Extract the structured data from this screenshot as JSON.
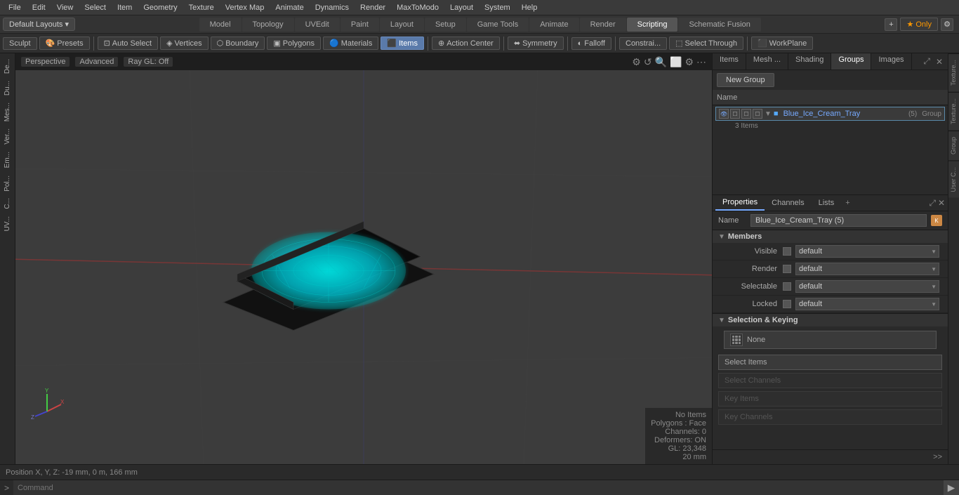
{
  "menu": {
    "items": [
      "File",
      "Edit",
      "View",
      "Select",
      "Item",
      "Geometry",
      "Texture",
      "Vertex Map",
      "Animate",
      "Dynamics",
      "Render",
      "MaxToModo",
      "Layout",
      "System",
      "Help"
    ]
  },
  "layout_bar": {
    "dropdown": "Default Layouts ▾",
    "tabs": [
      "Model",
      "Topology",
      "UVEdit",
      "Paint",
      "Layout",
      "Setup",
      "Game Tools",
      "Animate",
      "Render",
      "Scripting",
      "Schematic Fusion"
    ],
    "active_tab": "Scripting",
    "plus": "+",
    "star_only": "★ Only"
  },
  "toolbar": {
    "sculpt": "Sculpt",
    "presets": "Presets",
    "auto_select": "Auto Select",
    "vertices": "Vertices",
    "boundary": "Boundary",
    "polygons": "Polygons",
    "materials": "Materials",
    "items": "Items",
    "action_center": "Action Center",
    "symmetry": "Symmetry",
    "falloff": "Falloff",
    "constraint": "Constrai...",
    "select_through": "Select Through",
    "workplane": "WorkPlane"
  },
  "viewport": {
    "mode": "Perspective",
    "shading": "Advanced",
    "render": "Ray GL: Off",
    "status": {
      "no_items": "No Items",
      "polygons": "Polygons : Face",
      "channels": "Channels: 0",
      "deformers": "Deformers: ON",
      "gl": "GL: 23,348",
      "measure": "20 mm"
    }
  },
  "bottom_bar": {
    "position": "Position X, Y, Z:  -19 mm, 0 m, 166 mm"
  },
  "command_bar": {
    "arrow": ">",
    "placeholder": "Command",
    "go_label": "▶"
  },
  "right_panel": {
    "tabs": [
      "Items",
      "Mesh ...",
      "Shading",
      "Groups",
      "Images"
    ],
    "active_tab": "Groups",
    "new_group": "New Group",
    "list_header": "Name",
    "group": {
      "name": "Blue_Ice_Cream_Tray",
      "suffix": "(5)",
      "tag": "Group",
      "sub": "3 Items"
    },
    "props": {
      "tabs": [
        "Properties",
        "Channels",
        "Lists"
      ],
      "active_tab": "Properties",
      "name_label": "Name",
      "name_value": "Blue_Ice_Cream_Tray (5)",
      "sections": {
        "members": {
          "title": "Members",
          "visible_label": "Visible",
          "visible_value": "default",
          "render_label": "Render",
          "render_value": "default",
          "selectable_label": "Selectable",
          "selectable_value": "default",
          "locked_label": "Locked",
          "locked_value": "default"
        },
        "selection_keying": {
          "title": "Selection & Keying",
          "none_btn": "None",
          "select_items_btn": "Select Items",
          "select_channels_btn": "Select Channels",
          "key_items_btn": "Key Items",
          "key_channels_btn": "Key Channels"
        }
      }
    }
  },
  "left_sidebar": {
    "items": [
      "De...",
      "Du...",
      "Mes...",
      "Ver...",
      "Em...",
      "Pol...",
      "C...",
      "UV..."
    ]
  },
  "right_edge": {
    "tabs": [
      "Texture...",
      "Texture...",
      "Group",
      "User C..."
    ]
  },
  "icons": {
    "eye": "👁",
    "lock": "🔒",
    "gear": "⚙",
    "plus": "+",
    "expand": "▶",
    "collapse": "▼",
    "chevron_down": "▼",
    "chevron_right": "▶",
    "arrow_right": ">>",
    "dots": "⋯"
  }
}
